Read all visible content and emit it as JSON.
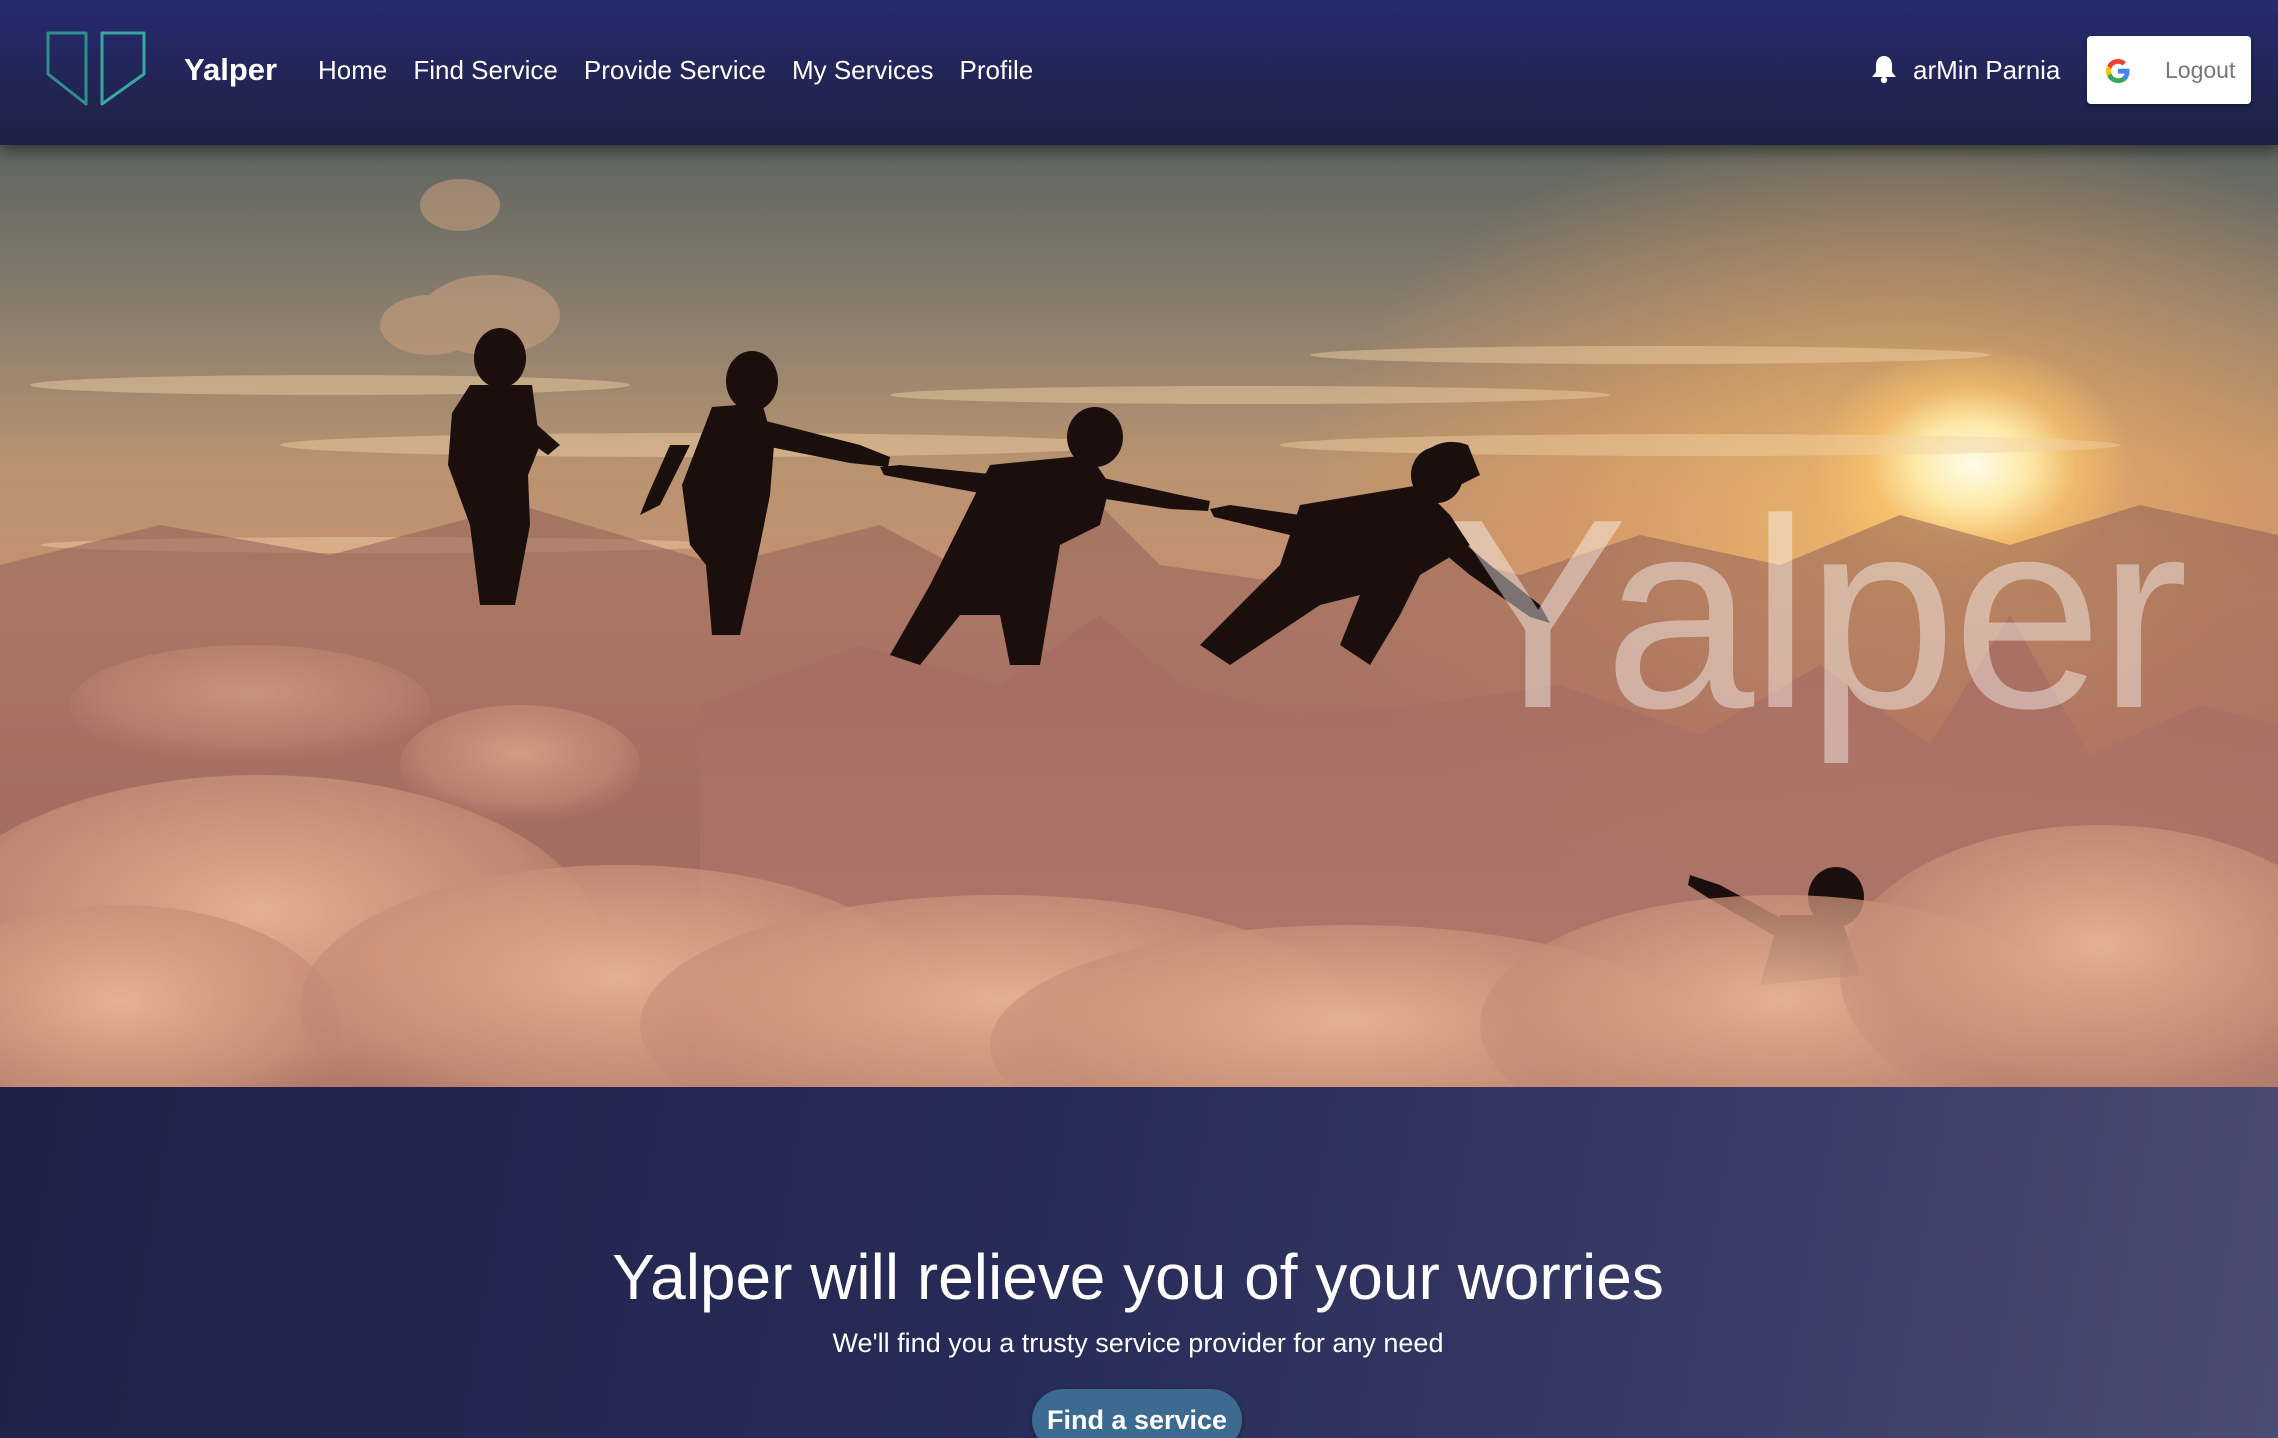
{
  "navbar": {
    "brand": "Yalper",
    "links": [
      "Home",
      "Find Service",
      "Provide Service",
      "My Services",
      "Profile"
    ],
    "user_name": "arMin Parnia",
    "logout_label": "Logout",
    "icons": {
      "logo": "yalper-logo-icon",
      "bell": "bell-icon",
      "google": "google-icon"
    }
  },
  "hero": {
    "watermark": "Yalper"
  },
  "banner": {
    "title": "Yalper will relieve you of your worries",
    "subtitle": "We'll find you a trusty service provider for any need",
    "cta_label": "Find a service"
  },
  "colors": {
    "navbar": "#23265a",
    "accent_logo": "#2f8f8c",
    "cta": "#3c6a90",
    "banner_start": "#1e2148",
    "banner_end": "#4a4c72"
  }
}
